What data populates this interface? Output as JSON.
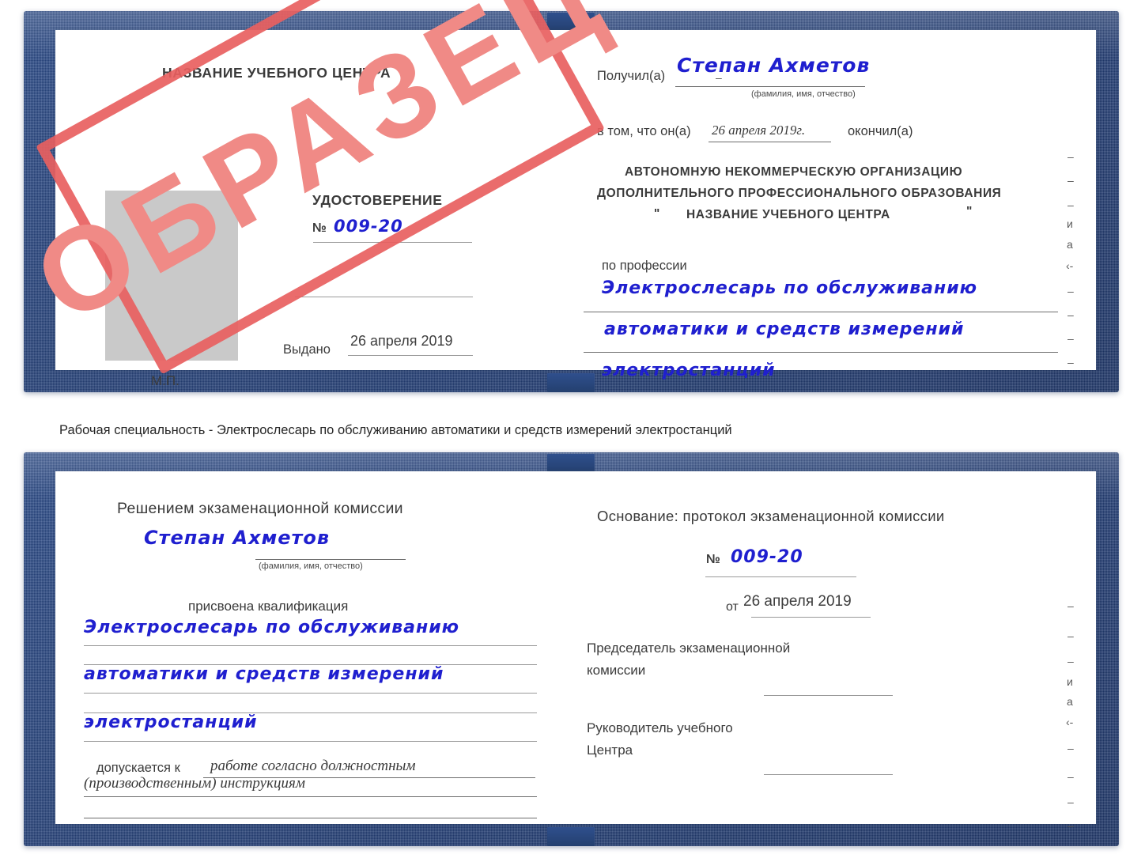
{
  "caption": {
    "text": "Рабочая специальность - Электрослесарь по обслуживанию автоматики и средств измерений электростанций"
  },
  "watermark": {
    "text": "ОБРАЗЕЦ",
    "frame_color": "#e8605f",
    "text_color": "#f08a86"
  },
  "colors": {
    "cover_blue": "#27447f",
    "handwriting_blue": "#1f1fcf",
    "printed_gray": "#3b3b3b",
    "rule_gray": "#9a9a9a",
    "photo_placeholder_gray": "#c9c9c9"
  },
  "certificate_top": {
    "left_page": {
      "header": "НАЗВАНИЕ УЧЕБНОГО ЦЕНТРА",
      "doc_type": "УДОСТОВЕРЕНИЕ",
      "number_label": "№",
      "number_value": "009-20",
      "issued_label": "Выдано",
      "issued_value": "26 апреля 2019",
      "seal_label": "М.П."
    },
    "right_page": {
      "received_label": "Получил(а)",
      "received_value": "Степан Ахметов",
      "received_hint": "(фамилия, имя, отчество)",
      "that_he_label": "в том, что он(а)",
      "that_he_value": "26 апреля 2019г.",
      "finished_label": "окончил(а)",
      "org_line1": "АВТОНОМНУЮ НЕКОММЕРЧЕСКУЮ ОРГАНИЗАЦИЮ",
      "org_line2": "ДОПОЛНИТЕЛЬНОГО ПРОФЕССИОНАЛЬНОГО ОБРАЗОВАНИЯ",
      "org_quote_open": "\"",
      "org_line3": "НАЗВАНИЕ УЧЕБНОГО ЦЕНТРА",
      "org_quote_close": "\"",
      "profession_label": "по профессии",
      "profession_line1": "Электрослесарь по обслуживанию",
      "profession_line2": "автоматики и средств измерений",
      "profession_line3": "электростанций",
      "edge_marks": [
        "–",
        "–",
        "–",
        "–",
        "и",
        "а",
        "‹-",
        "–",
        "–",
        "–",
        "–"
      ]
    }
  },
  "certificate_bottom": {
    "left_page": {
      "decision_header": "Решением экзаменационной комиссии",
      "name_value": "Степан Ахметов",
      "name_hint": "(фамилия, имя, отчество)",
      "qualification_label": "присвоена квалификация",
      "qualification_line1": "Электрослесарь по обслуживанию",
      "qualification_line2": "автоматики и средств измерений",
      "qualification_line3": "электростанций",
      "admitted_label": "допускается к",
      "admitted_value_line1": "работе согласно должностным",
      "admitted_value_line2": "(производственным) инструкциям"
    },
    "right_page": {
      "basis_label": "Основание: протокол экзаменационной комиссии",
      "protocol_number_label": "№",
      "protocol_number_value": "009-20",
      "protocol_date_label": "от",
      "protocol_date_value": "26 апреля 2019",
      "chairman_line1": "Председатель экзаменационной",
      "chairman_line2": "комиссии",
      "head_line1": "Руководитель учебного",
      "head_line2": "Центра",
      "edge_marks": [
        "–",
        "–",
        "–",
        "и",
        "а",
        "‹-",
        "–",
        "–",
        "–",
        "–"
      ]
    }
  }
}
